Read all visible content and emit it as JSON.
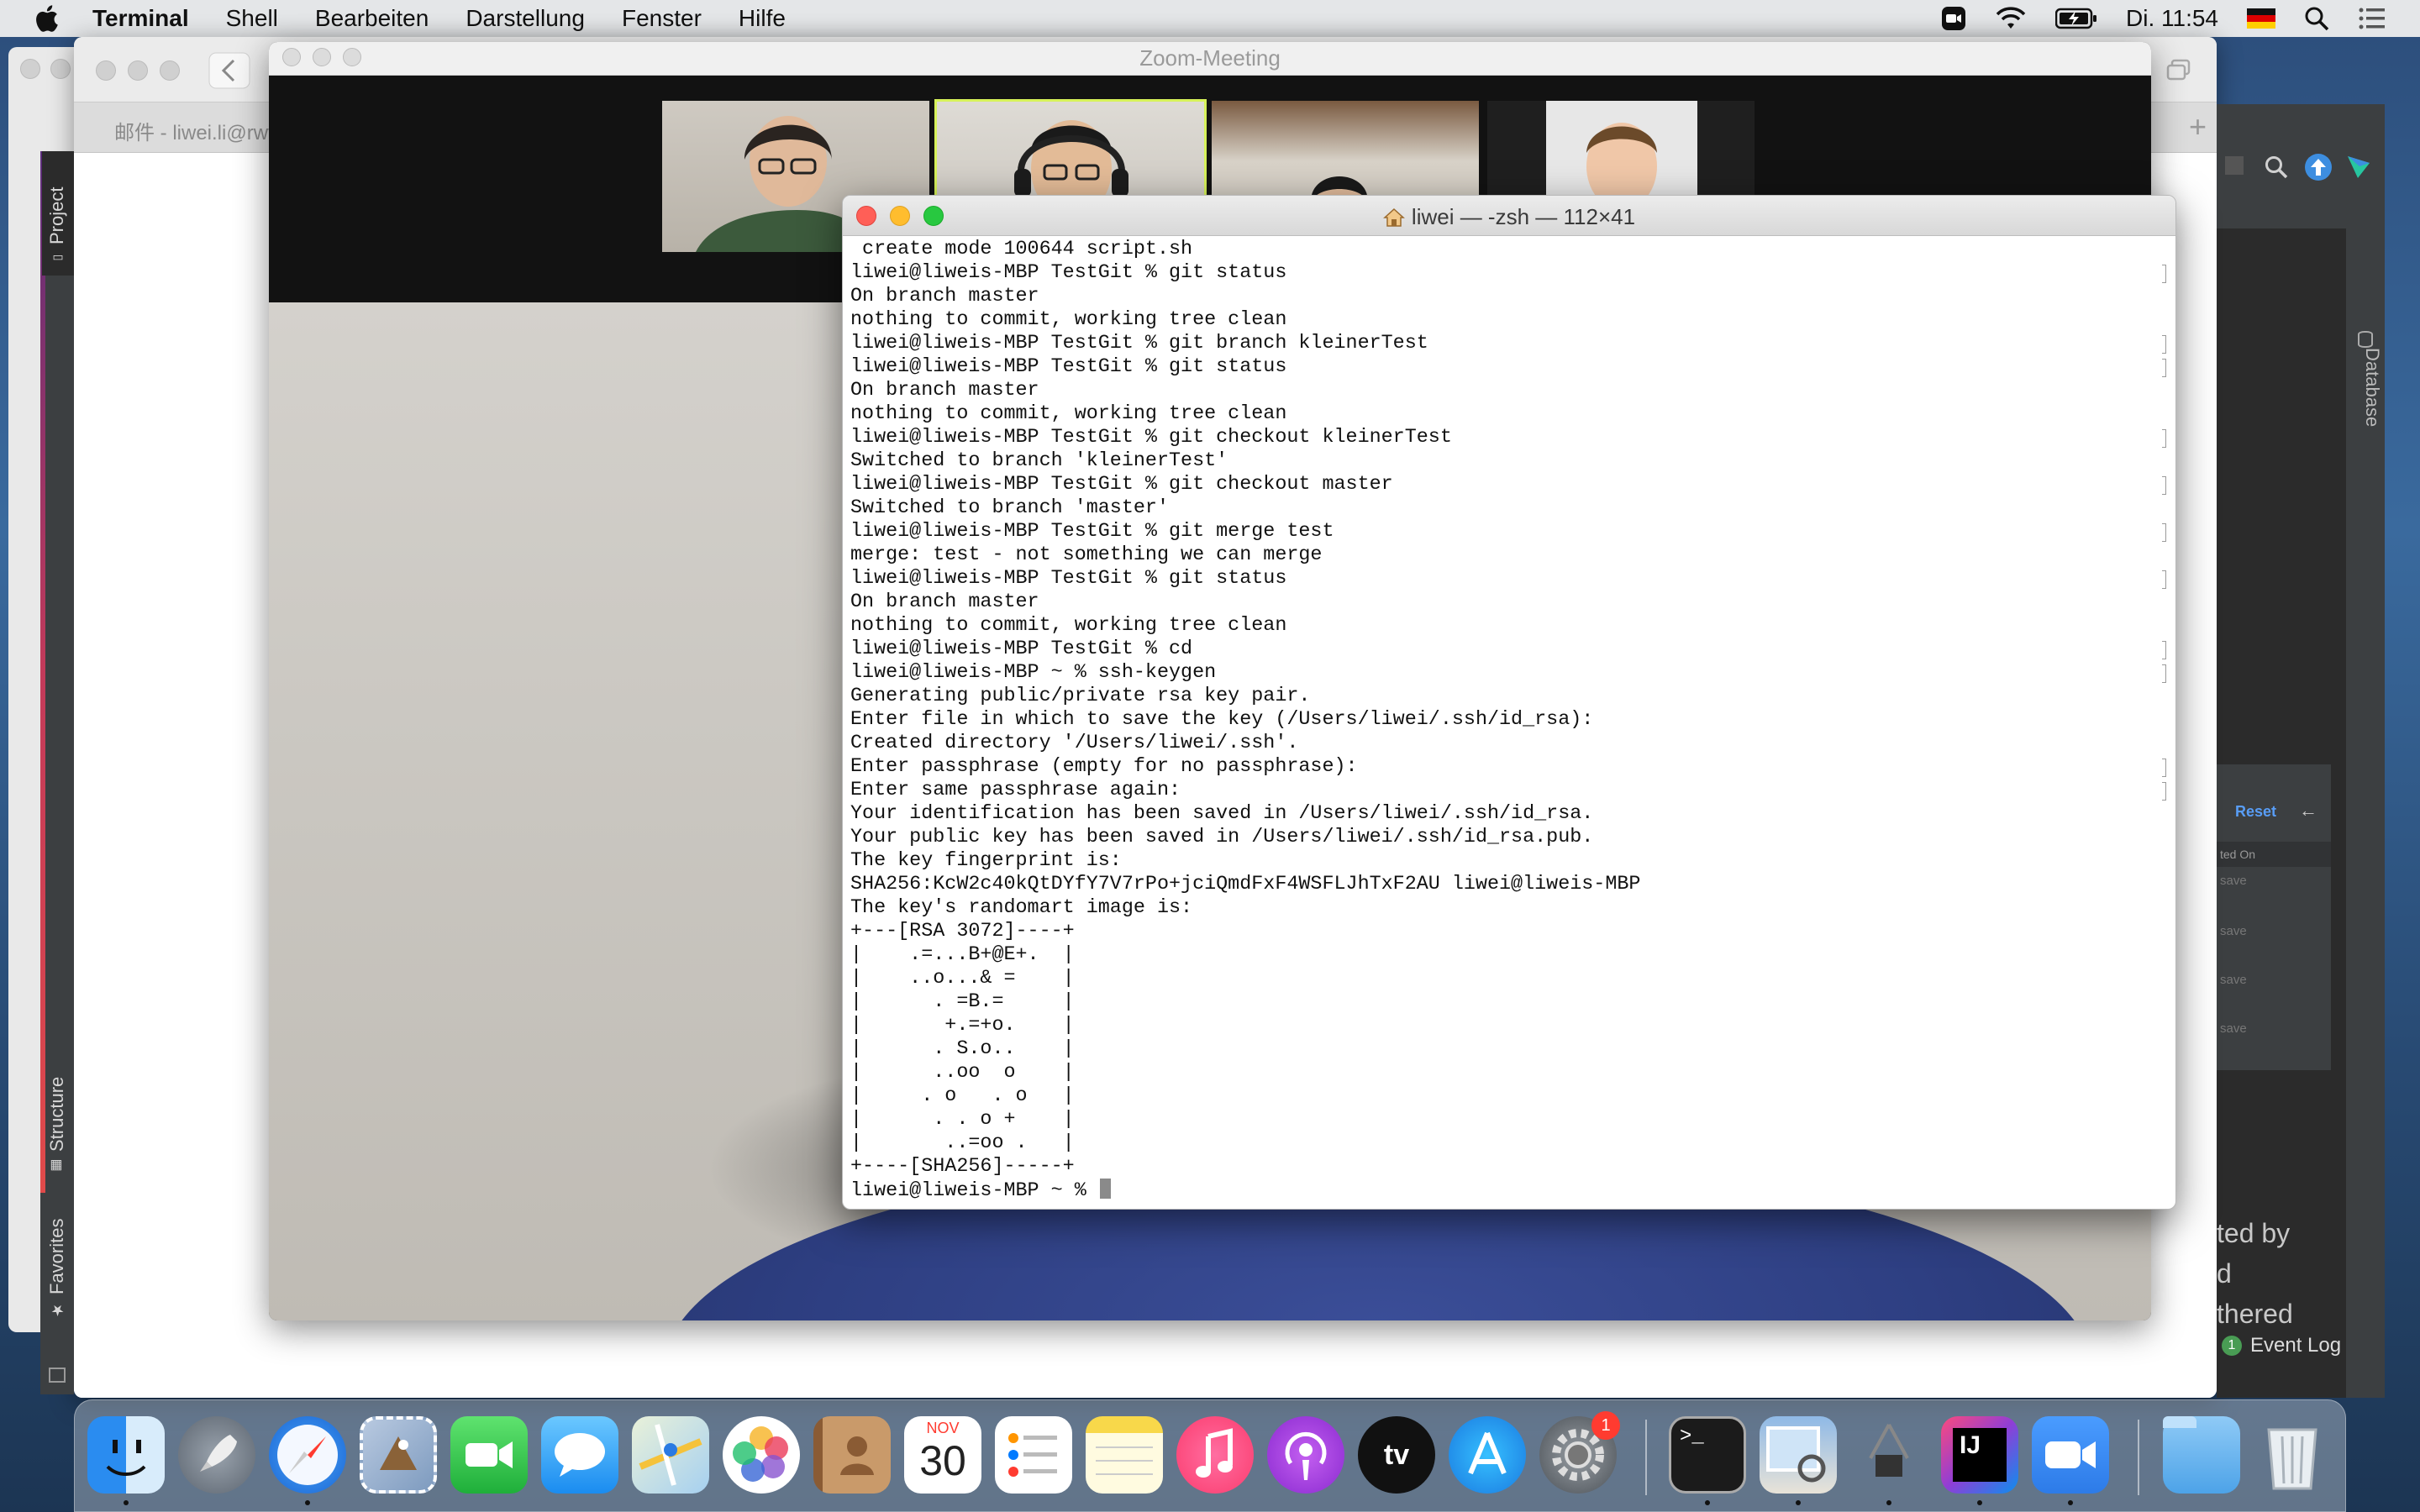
{
  "menubar": {
    "app_name": "Terminal",
    "items": [
      "Shell",
      "Bearbeiten",
      "Darstellung",
      "Fenster",
      "Hilfe"
    ],
    "clock": "Di. 11:54"
  },
  "mail": {
    "tab_title": "邮件 - liwei.li@rwt"
  },
  "intellij": {
    "left_tabs": [
      "Project",
      "Structure",
      "Favorites"
    ],
    "right_tab": "Database",
    "reset_label": "Reset",
    "column_header": "ted On",
    "save_rows": [
      "save",
      "save",
      "save",
      "save"
    ],
    "faint_lines": [
      "ted by",
      "d",
      "thered"
    ],
    "event_log_count": "1",
    "event_log_label": "Event Log"
  },
  "zoom": {
    "title": "Zoom-Meeting"
  },
  "terminal": {
    "title": "liwei — -zsh — 112×41",
    "lines": [
      {
        "text": " create mode 100644 script.sh",
        "mark": false
      },
      {
        "text": "liwei@liweis-MBP TestGit % git status",
        "mark": true
      },
      {
        "text": "On branch master",
        "mark": false
      },
      {
        "text": "nothing to commit, working tree clean",
        "mark": false
      },
      {
        "text": "liwei@liweis-MBP TestGit % git branch kleinerTest",
        "mark": true
      },
      {
        "text": "liwei@liweis-MBP TestGit % git status",
        "mark": true
      },
      {
        "text": "On branch master",
        "mark": false
      },
      {
        "text": "nothing to commit, working tree clean",
        "mark": false
      },
      {
        "text": "liwei@liweis-MBP TestGit % git checkout kleinerTest",
        "mark": true
      },
      {
        "text": "Switched to branch 'kleinerTest'",
        "mark": false
      },
      {
        "text": "liwei@liweis-MBP TestGit % git checkout master",
        "mark": true
      },
      {
        "text": "Switched to branch 'master'",
        "mark": false
      },
      {
        "text": "liwei@liweis-MBP TestGit % git merge test",
        "mark": true
      },
      {
        "text": "merge: test - not something we can merge",
        "mark": false
      },
      {
        "text": "liwei@liweis-MBP TestGit % git status",
        "mark": true
      },
      {
        "text": "On branch master",
        "mark": false
      },
      {
        "text": "nothing to commit, working tree clean",
        "mark": false
      },
      {
        "text": "liwei@liweis-MBP TestGit % cd",
        "mark": true
      },
      {
        "text": "liwei@liweis-MBP ~ % ssh-keygen",
        "mark": true
      },
      {
        "text": "Generating public/private rsa key pair.",
        "mark": false
      },
      {
        "text": "Enter file in which to save the key (/Users/liwei/.ssh/id_rsa):",
        "mark": false
      },
      {
        "text": "Created directory '/Users/liwei/.ssh'.",
        "mark": false
      },
      {
        "text": "Enter passphrase (empty for no passphrase):",
        "mark": true
      },
      {
        "text": "Enter same passphrase again:",
        "mark": true
      },
      {
        "text": "Your identification has been saved in /Users/liwei/.ssh/id_rsa.",
        "mark": false
      },
      {
        "text": "Your public key has been saved in /Users/liwei/.ssh/id_rsa.pub.",
        "mark": false
      },
      {
        "text": "The key fingerprint is:",
        "mark": false
      },
      {
        "text": "SHA256:KcW2c40kQtDYfY7V7rPo+jciQmdFxF4WSFLJhTxF2AU liwei@liweis-MBP",
        "mark": false
      },
      {
        "text": "The key's randomart image is:",
        "mark": false
      },
      {
        "text": "+---[RSA 3072]----+",
        "mark": false
      },
      {
        "text": "|    .=...B+@E+.  |",
        "mark": false
      },
      {
        "text": "|    ..o...& =    |",
        "mark": false
      },
      {
        "text": "|      . =B.=     |",
        "mark": false
      },
      {
        "text": "|       +.=+o.    |",
        "mark": false
      },
      {
        "text": "|      . S.o..    |",
        "mark": false
      },
      {
        "text": "|      ..oo  o    |",
        "mark": false
      },
      {
        "text": "|     . o   . o   |",
        "mark": false
      },
      {
        "text": "|      . . o +    |",
        "mark": false
      },
      {
        "text": "|       ..=oo .   |",
        "mark": false
      },
      {
        "text": "+----[SHA256]-----+",
        "mark": false
      }
    ],
    "prompt": "liwei@liweis-MBP ~ % "
  },
  "dock": {
    "apps": [
      "finder-icon",
      "launchpad-icon",
      "safari-icon",
      "mail-icon",
      "facetime-icon",
      "messages-icon",
      "maps-icon",
      "photos-icon",
      "contacts-icon",
      "calendar-icon",
      "reminders-icon",
      "notes-icon",
      "music-icon",
      "podcasts-icon",
      "tv-icon",
      "app-store-icon",
      "system-preferences-icon",
      "terminal-icon",
      "preview-icon",
      "system-information-icon",
      "intellij-icon",
      "zoom-icon",
      "downloads-folder-icon",
      "trash-icon"
    ],
    "calendar_month": "NOV",
    "calendar_day": "30",
    "tv_label": "tv",
    "intellij_label": "IJ",
    "system_prefs_badge": "1"
  }
}
